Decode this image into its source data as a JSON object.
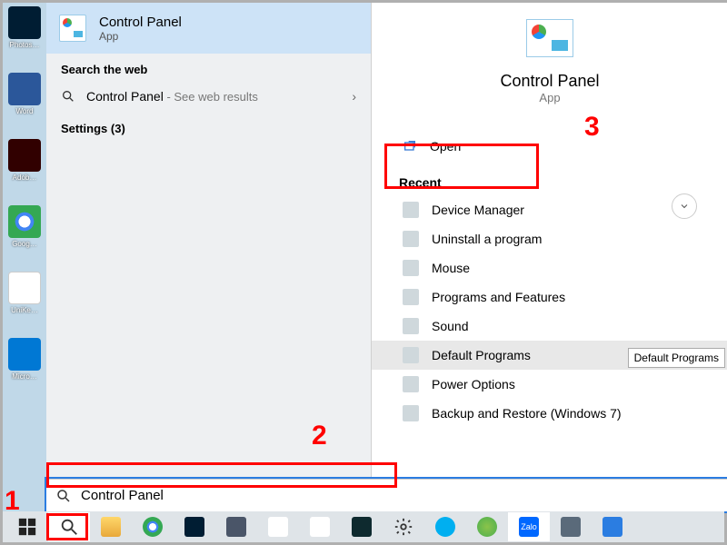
{
  "best_match": {
    "title": "Control Panel",
    "subtitle": "App"
  },
  "left": {
    "web_header": "Search the web",
    "web_item": "Control Panel",
    "web_suffix": " - See web results",
    "settings_header": "Settings (3)"
  },
  "detail": {
    "title": "Control Panel",
    "subtitle": "App",
    "open": "Open",
    "recent_header": "Recent",
    "recent": [
      "Device Manager",
      "Uninstall a program",
      "Mouse",
      "Programs and Features",
      "Sound",
      "Default Programs",
      "Power Options",
      "Backup and Restore (Windows 7)"
    ],
    "tooltip": "Default Programs"
  },
  "search": {
    "value": "Control Panel"
  },
  "annotations": {
    "a1": "1",
    "a2": "2",
    "a3": "3"
  },
  "taskbar_icons": [
    "start",
    "search",
    "file-explorer",
    "chrome",
    "photoshop",
    "calculator",
    "office",
    "snip",
    "filmora",
    "settings",
    "skype",
    "paint",
    "zalo",
    "projector",
    "contact"
  ]
}
